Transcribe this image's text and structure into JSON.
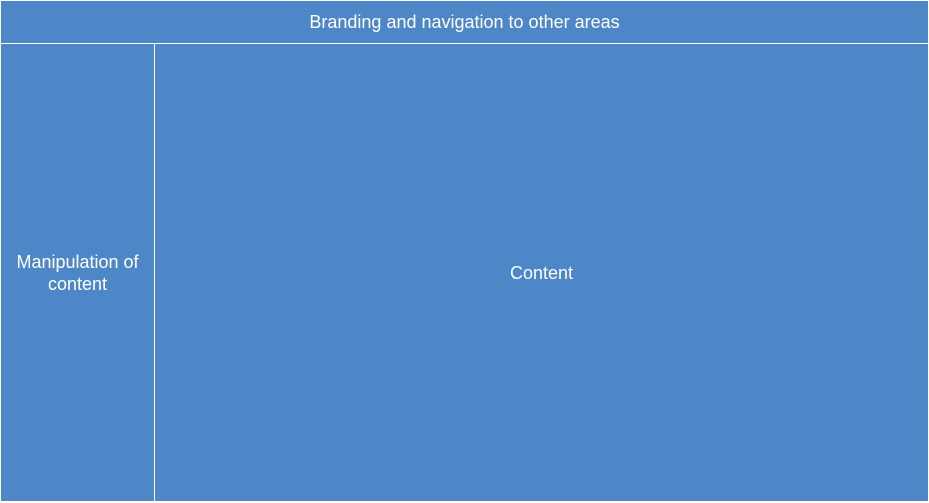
{
  "colors": {
    "region_fill": "#4d87c7",
    "divider": "#ffffff",
    "text": "#ffffff"
  },
  "header": {
    "label": "Branding and navigation to other areas"
  },
  "sidebar": {
    "label": "Manipulation of content"
  },
  "content": {
    "label": "Content"
  }
}
